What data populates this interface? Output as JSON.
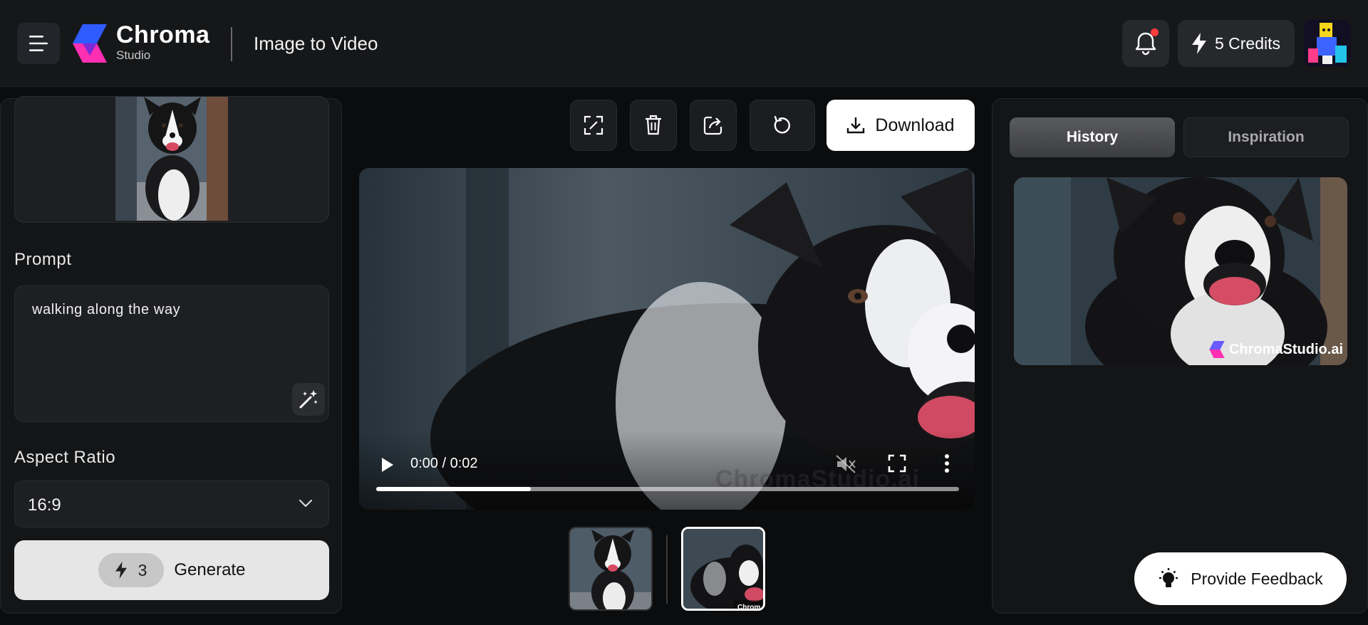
{
  "header": {
    "brand_name": "Chroma",
    "brand_sub": "Studio",
    "page_title": "Image to Video",
    "credits_label": "5 Credits"
  },
  "left_panel": {
    "prompt_label": "Prompt",
    "prompt_value": "walking along the way",
    "aspect_label": "Aspect Ratio",
    "aspect_value": "16:9",
    "generate_cost": "3",
    "generate_label": "Generate"
  },
  "toolbar": {
    "download_label": "Download",
    "icons": [
      "expand-icon",
      "trash-icon",
      "share-icon",
      "refresh-icon",
      "download-icon"
    ]
  },
  "video": {
    "time": "0:00 / 0:02",
    "progress_fraction": 0.265,
    "muted": true
  },
  "right_panel": {
    "tabs": [
      "History",
      "Inspiration"
    ],
    "active_tab": "History",
    "card_watermark": "ChromaStudio.ai"
  },
  "feedback_label": "Provide Feedback",
  "colors": {
    "background": "#0b0c0d",
    "panel": "#141517",
    "accent_blue": "#2f5bff",
    "accent_pink": "#ff2fb3",
    "notification_dot": "#ff3b3b"
  }
}
